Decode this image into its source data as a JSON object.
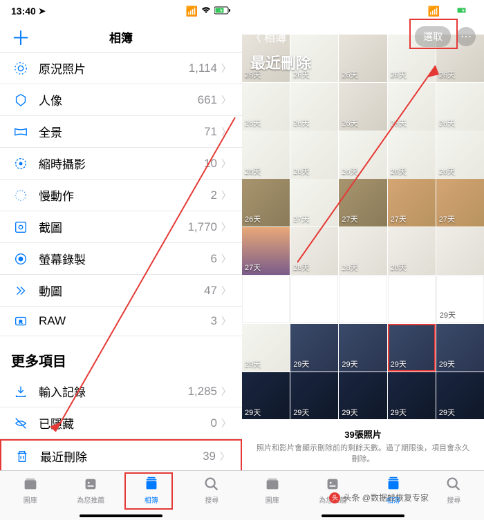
{
  "status": {
    "time": "13:40",
    "location_icon": "⁠",
    "signals": "•ıl 🕈",
    "battery_icon": "🔋"
  },
  "left_phone": {
    "header_title": "相簿",
    "plus": "＋",
    "albums": [
      {
        "icon": "burst",
        "name": "原況照片",
        "count": "1,114"
      },
      {
        "icon": "person",
        "name": "人像",
        "count": "661"
      },
      {
        "icon": "pano",
        "name": "全景",
        "count": "71"
      },
      {
        "icon": "timelapse",
        "name": "縮時攝影",
        "count": "10"
      },
      {
        "icon": "slomo",
        "name": "慢動作",
        "count": "2"
      },
      {
        "icon": "screenshot",
        "name": "截圖",
        "count": "1,770"
      },
      {
        "icon": "record",
        "name": "螢幕錄製",
        "count": "6"
      },
      {
        "icon": "animated",
        "name": "動圖",
        "count": "47"
      },
      {
        "icon": "raw",
        "name": "RAW",
        "count": "3"
      }
    ],
    "more_section": "更多項目",
    "more_items": [
      {
        "icon": "import",
        "name": "輸入記錄",
        "count": "1,285"
      },
      {
        "icon": "hidden",
        "name": "已隱藏",
        "count": "0"
      },
      {
        "icon": "trash",
        "name": "最近刪除",
        "count": "39",
        "highlighted": true
      }
    ]
  },
  "right_phone": {
    "back_label": "相簿",
    "title": "最近刪除",
    "select_label": "選取",
    "more_label": "⋯",
    "photo_days": [
      "26天",
      "26天",
      "26天",
      "26天",
      "26天",
      "26天",
      "26天",
      "26天",
      "26天",
      "26天",
      "26天",
      "26天",
      "26天",
      "26天",
      "26天",
      "26天",
      "27天",
      "27天",
      "27天",
      "27天",
      "27天",
      "28天",
      "28天",
      "28天",
      "",
      "",
      "",
      "",
      "",
      "29天",
      "29天",
      "29天",
      "29天",
      "29天",
      "29天",
      "29天",
      "29天",
      "29天",
      "29天",
      "29天"
    ],
    "footer_count": "39張照片",
    "footer_desc": "照片和影片會顯示刪除前的剩餘天數。過了期限後，項目會永久刪除。"
  },
  "tabs": [
    {
      "name": "library",
      "label": "圖庫"
    },
    {
      "name": "foryou",
      "label": "為您推薦"
    },
    {
      "name": "albums",
      "label": "相簿",
      "active": true
    },
    {
      "name": "search",
      "label": "搜尋"
    }
  ],
  "watermark": "头条 @数据蛙恢复专家"
}
